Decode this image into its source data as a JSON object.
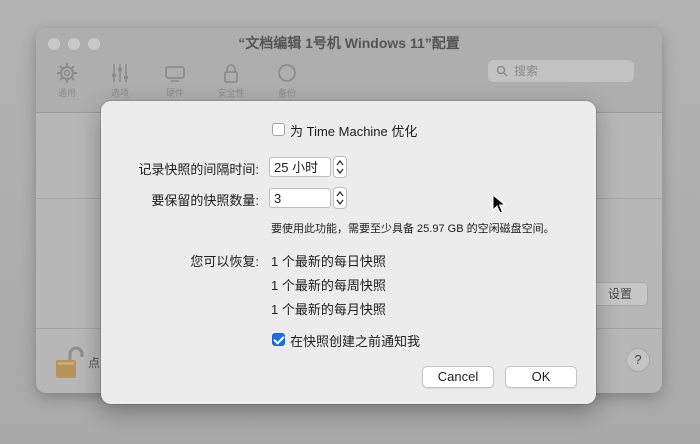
{
  "window": {
    "title": "“文档编辑 1号机 Windows 11”配置",
    "toolbar": [
      {
        "label": "通用",
        "icon": "gear-icon"
      },
      {
        "label": "选项",
        "icon": "sliders-icon"
      },
      {
        "label": "硬件",
        "icon": "display-icon"
      },
      {
        "label": "安全性",
        "icon": "lock-icon"
      },
      {
        "label": "备份",
        "icon": "backup-icon"
      }
    ],
    "search_placeholder": "搜索",
    "settings_button": "设置",
    "lock_text": "点",
    "help_label": "?"
  },
  "sheet": {
    "time_machine_label": "为 Time Machine 优化",
    "time_machine_checked": false,
    "interval_label": "记录快照的间隔时间:",
    "interval_value": "25 小时",
    "count_label": "要保留的快照数量:",
    "count_value": "3",
    "space_note": "要使用此功能，需要至少具备 25.97 GB 的空闲磁盘空间。",
    "restore_label": "您可以恢复:",
    "restore_items": [
      "1 个最新的每日快照",
      "1 个最新的每周快照",
      "1 个最新的每月快照"
    ],
    "notify_label": "在快照创建之前通知我",
    "notify_checked": true,
    "cancel_label": "Cancel",
    "ok_label": "OK"
  },
  "colors": {
    "accent": "#1f6fe0"
  }
}
